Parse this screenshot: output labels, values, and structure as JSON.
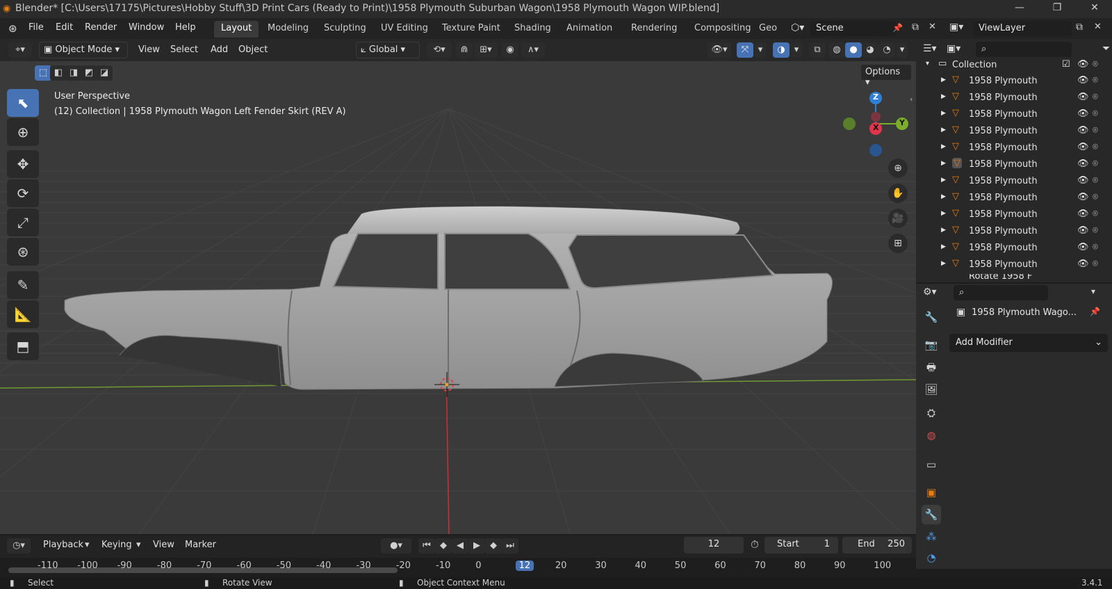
{
  "window": {
    "title": "Blender* [C:\\Users\\17175\\Pictures\\Hobby Stuff\\3D Print Cars (Ready to Print)\\1958 Plymouth Suburban Wagon\\1958 Plymouth Wagon WIP.blend]",
    "minimize": "—",
    "maximize": "❐",
    "close": "✕"
  },
  "menubar": {
    "items": [
      "File",
      "Edit",
      "Render",
      "Window",
      "Help"
    ],
    "workspaces": [
      "Layout",
      "Modeling",
      "Sculpting",
      "UV Editing",
      "Texture Paint",
      "Shading",
      "Animation",
      "Rendering",
      "Compositing",
      "Geo"
    ],
    "scene": "Scene",
    "view_layer": "ViewLayer"
  },
  "viewport_header": {
    "mode": "Object Mode",
    "menus": [
      "View",
      "Select",
      "Add",
      "Object"
    ],
    "transform_orientation": "Global",
    "options_label": "Options"
  },
  "viewport": {
    "perspective": "User Perspective",
    "collection_info": "(12) Collection | 1958 Plymouth Wagon Left Fender Skirt (REV A)",
    "gizmo": {
      "x": "X",
      "y": "Y",
      "z": "Z"
    },
    "colors": {
      "x_axis": "#e0354a",
      "y_axis": "#7aad2a",
      "z_axis": "#2f7fd6",
      "grid_bg": "#3a3a3a"
    }
  },
  "outliner": {
    "collection": "Collection",
    "items": [
      "1958 Plymouth",
      "1958 Plymouth",
      "1958 Plymouth",
      "1958 Plymouth",
      "1958 Plymouth",
      "1958 Plymouth",
      "1958 Plymouth",
      "1958 Plymouth",
      "1958 Plymouth",
      "1958 Plymouth",
      "1958 Plymouth",
      "1958 Plymouth"
    ],
    "partial_item": "Rotate 1958 F"
  },
  "properties": {
    "object_name": "1958 Plymouth Wago...",
    "add_modifier": "Add Modifier"
  },
  "timeline": {
    "menus": [
      "Playback",
      "Keying",
      "View",
      "Marker"
    ],
    "current_frame": "12",
    "start_label": "Start",
    "start": "1",
    "end_label": "End",
    "end": "250",
    "ruler": [
      "-110",
      "-100",
      "-90",
      "-80",
      "-70",
      "-60",
      "-50",
      "-40",
      "-30",
      "-20",
      "-10",
      "0",
      "12",
      "20",
      "30",
      "40",
      "50",
      "60",
      "70",
      "80",
      "90",
      "100"
    ]
  },
  "statusbar": {
    "select": "Select",
    "rotate": "Rotate View",
    "context": "Object Context Menu",
    "version": "3.4.1"
  }
}
